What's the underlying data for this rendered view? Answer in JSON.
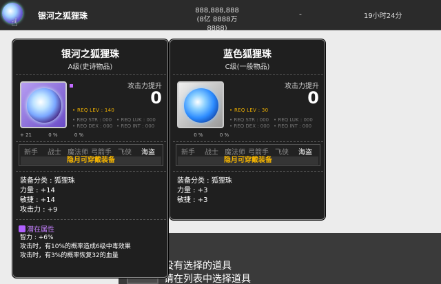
{
  "list_row": {
    "name": "银河之狐狸珠",
    "price_line1": "888,888,888",
    "price_line2": "(8亿 8888万 8888)",
    "dash": "-",
    "time_left": "19小时24分"
  },
  "empty_state": {
    "title": "没有选择的道具",
    "subtitle": "请在列表中选择道具"
  },
  "cards": [
    {
      "title": "银河之狐狸珠",
      "grade": "A级(史诗物品)",
      "attack_label": "攻击力提升",
      "attack_value": "0",
      "req_lev": "• REQ LEV : 140",
      "req_str": "• REQ STR : 000",
      "req_luk": "• REQ LUK : 000",
      "req_dex": "• REQ DEX : 000",
      "req_int": "• REQ INT : 000",
      "badge1": "+ 21",
      "badge2": "0 %",
      "badge3": "0 %",
      "jobs": [
        "新手",
        "战士",
        "魔法师",
        "弓箭手",
        "飞侠",
        "海盗"
      ],
      "hint": "隐月可穿戴装备",
      "stats": [
        "装备分类 : 狐狸珠",
        "力量 : +14",
        "敏捷 : +14",
        "攻击力 : +9"
      ],
      "potential_title": "潜在属性",
      "potential_lines": [
        "智力 : +6%",
        "攻击时，有10%的概率造成6级中毒效果",
        "攻击时，有3%的概率恢复32的血量"
      ]
    },
    {
      "title": "蓝色狐狸珠",
      "grade": "C级(一般物品)",
      "attack_label": "攻击力提升",
      "attack_value": "0",
      "req_lev": "• REQ LEV : 30",
      "req_str": "• REQ STR : 000",
      "req_luk": "• REQ LUK : 000",
      "req_dex": "• REQ DEX : 000",
      "req_int": "• REQ INT : 000",
      "badge1": "",
      "badge2": "0 %",
      "badge3": "0 %",
      "jobs": [
        "新手",
        "战士",
        "魔法师",
        "弓箭手",
        "飞侠",
        "海盗"
      ],
      "hint": "隐月可穿戴装备",
      "stats": [
        "装备分类 : 狐狸珠",
        "力量 : +3",
        "敏捷 : +3"
      ]
    }
  ]
}
